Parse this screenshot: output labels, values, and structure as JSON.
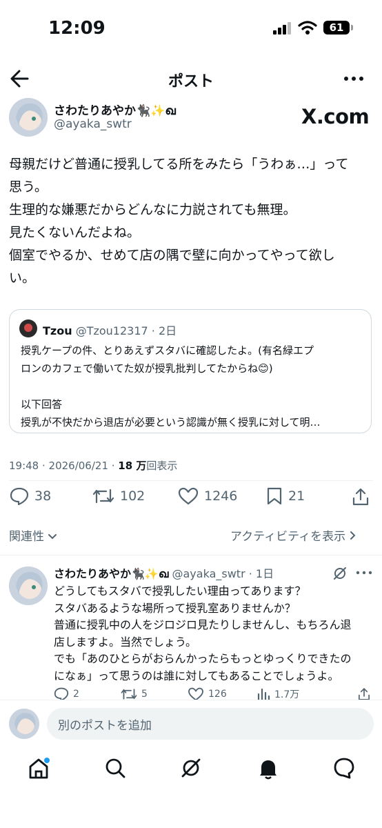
{
  "status_bar": {
    "time": "12:09",
    "battery": "61"
  },
  "header": {
    "title": "ポスト"
  },
  "post": {
    "author_name": "さわたりあやか🐈‍⬛✨ഖ",
    "handle": "@ayaka_swtr",
    "watermark": "X.com",
    "lines": [
      "母親だけど普通に授乳してる所をみたら「うわぁ…」って",
      "思う。",
      "生理的な嫌悪だからどんなに力説されても無理。",
      "見たくないんだよね。",
      "個室でやるか、せめて店の隅で壁に向かってやって欲し",
      "い。"
    ],
    "quote": {
      "name": "Tzou",
      "handle": "@Tzou12317",
      "time": "· 2日",
      "lines": [
        "授乳ケープの件、とりあえずスタバに確認したよ。(有名緑エプ",
        "ロンのカフェで働いてた奴が授乳批判してたからね😊)",
        "",
        "以下回答",
        "授乳が不快だから退店が必要という認識が無く授乳に対して明…"
      ]
    },
    "meta": {
      "datetime": "19:48 · 2026/06/21 · ",
      "views": "18 万",
      "views_label": "回表示"
    },
    "stats": {
      "replies": "38",
      "reposts": "102",
      "likes": "1246",
      "bookmarks": "21"
    }
  },
  "relevance": {
    "label": "関連性",
    "activity": "アクティビティを表示"
  },
  "reply": {
    "author_name": "さわたりあやか🐈‍⬛✨ഖ",
    "handle": "@ayaka_swtr",
    "time": "· 1日",
    "lines": [
      "どうしてもスタバで授乳したい理由ってあります？",
      "スタバあるような場所って授乳室ありませんか？",
      "普通に授乳中の人をジロジロ見たりしませんし、もちろん退",
      "店しますよ。当然でしょう。",
      "でも「あのひとらがおらんかったらもっとゆっくりできたの",
      "になぁ」って思うのは誰に対してもあることでしょうよ。"
    ],
    "stats": {
      "replies": "2",
      "reposts": "5",
      "likes": "126",
      "views": "1.7万"
    }
  },
  "composer": {
    "placeholder": "別のポストを追加"
  },
  "colors": {
    "text": "#0f1419",
    "secondary": "#536471",
    "border": "#cfd9de",
    "accent": "#1d9bf0"
  }
}
